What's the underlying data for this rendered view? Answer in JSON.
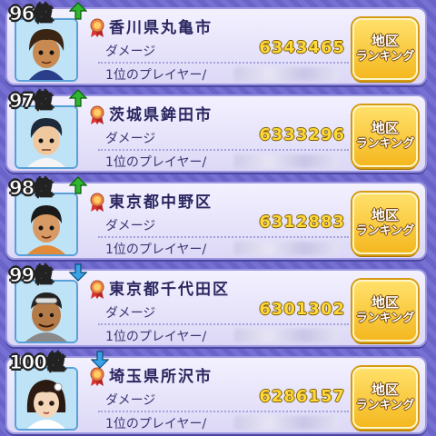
{
  "ranking": [
    {
      "rank": "96位",
      "trend": "up",
      "region": "香川県丸亀市",
      "damage_label": "ダメージ",
      "score": "6343465",
      "top_player_label": "1位のプレイヤー/",
      "button": {
        "line1": "地区",
        "line2": "ランキング"
      }
    },
    {
      "rank": "97位",
      "trend": "up",
      "region": "茨城県鉾田市",
      "damage_label": "ダメージ",
      "score": "6333296",
      "top_player_label": "1位のプレイヤー/",
      "button": {
        "line1": "地区",
        "line2": "ランキング"
      }
    },
    {
      "rank": "98位",
      "trend": "up",
      "region": "東京都中野区",
      "damage_label": "ダメージ",
      "score": "6312883",
      "top_player_label": "1位のプレイヤー/",
      "button": {
        "line1": "地区",
        "line2": "ランキング"
      }
    },
    {
      "rank": "99位",
      "trend": "down",
      "region": "東京都千代田区",
      "damage_label": "ダメージ",
      "score": "6301302",
      "top_player_label": "1位のプレイヤー/",
      "button": {
        "line1": "地区",
        "line2": "ランキング"
      }
    },
    {
      "rank": "100位",
      "trend": "down",
      "region": "埼玉県所沢市",
      "damage_label": "ダメージ",
      "score": "6286157",
      "top_player_label": "1位のプレイヤー/",
      "button": {
        "line1": "地区",
        "line2": "ランキング"
      }
    }
  ],
  "colors": {
    "up_arrow": "#2fb52f",
    "down_arrow": "#3aa3e6",
    "score": "#ffd83a",
    "button": "#f4b820"
  }
}
